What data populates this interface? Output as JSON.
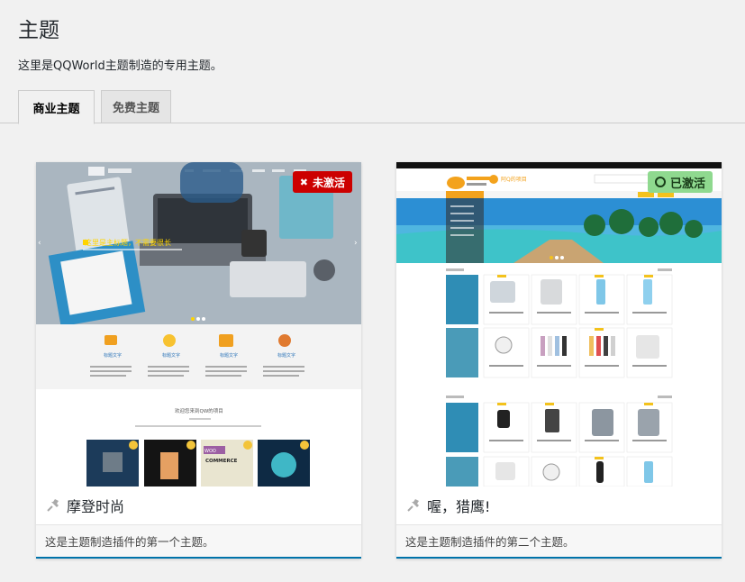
{
  "page": {
    "title": "主题",
    "description": "这里是QQWorld主题制造的专用主题。"
  },
  "tabs": [
    {
      "label": "商业主题",
      "active": true
    },
    {
      "label": "免费主题",
      "active": false
    }
  ],
  "themes": [
    {
      "name": "摩登时尚",
      "description": "这是主题制造插件的第一个主题。",
      "status_label": "未激活",
      "status": "inactive",
      "preview": {
        "banner_text": "这里是主标题，不需要很长",
        "features": [
          "标题文字",
          "标题文字",
          "标题文字",
          "标题文字"
        ],
        "section_title": "欢迎您来到QW的项目",
        "products": [
          "",
          "",
          "WOO COMMERCE",
          ""
        ]
      }
    },
    {
      "name": "喔，猎鹰!",
      "description": "这是主题制造插件的第二个主题。",
      "status_label": "已激活",
      "status": "active",
      "preview": {
        "logo_text": "阿Q的项目"
      }
    }
  ],
  "colors": {
    "accent": "#0073aa",
    "inactive_badge": "#cc0000",
    "active_badge": "#8fd98f"
  }
}
